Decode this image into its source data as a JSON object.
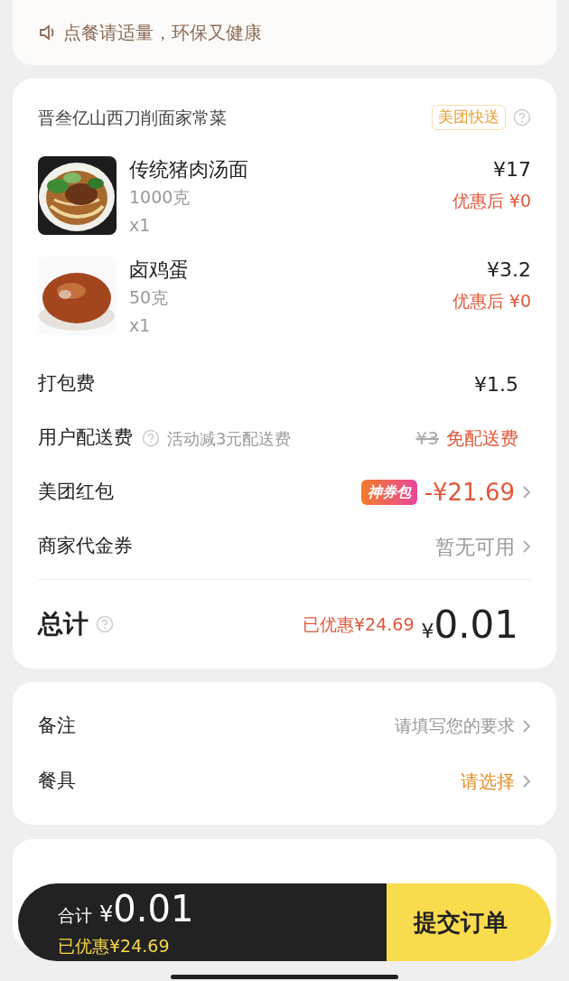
{
  "notice": {
    "text": "点餐请适量，环保又健康"
  },
  "shop": {
    "name": "晋叁亿山西刀削面家常菜",
    "delivery_tag": "美团快送"
  },
  "items": [
    {
      "kind": "noodles",
      "name": "传统猪肉汤面",
      "weight": "1000克",
      "quantity": "x1",
      "price": "¥17",
      "discounted": "优惠后 ¥0"
    },
    {
      "kind": "egg",
      "name": "卤鸡蛋",
      "weight": "50克",
      "quantity": "x1",
      "price": "¥3.2",
      "discounted": "优惠后 ¥0"
    }
  ],
  "fees": [
    {
      "kind": "plain",
      "label": "打包费",
      "value": "¥1.5"
    },
    {
      "kind": "delivery",
      "label": "用户配送费",
      "note": "活动减3元配送费",
      "original": "¥3",
      "value": "免配送费"
    },
    {
      "kind": "coupon",
      "label": "美团红包",
      "badge": "神券包",
      "value": "-¥21.69"
    },
    {
      "kind": "muted",
      "label": "商家代金券",
      "value": "暂无可用"
    }
  ],
  "total": {
    "label": "总计",
    "saved": "已优惠¥24.69",
    "currency": "¥",
    "amount": "0.01"
  },
  "options": [
    {
      "kind": "placeholder",
      "label": "备注",
      "placeholder": "请填写您的要求"
    },
    {
      "kind": "select",
      "label": "餐具",
      "value": "请选择"
    }
  ],
  "footer": {
    "label": "合计",
    "currency": "¥",
    "amount": "0.01",
    "saved": "已优惠¥24.69",
    "submit": "提交订单"
  }
}
